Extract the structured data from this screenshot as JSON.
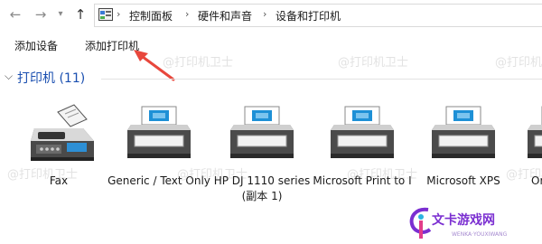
{
  "nav": {
    "back_icon": "arrow-left-icon",
    "forward_icon": "arrow-right-icon",
    "dropdown_icon": "chevron-down-icon",
    "up_icon": "arrow-up-icon"
  },
  "address": {
    "icon": "control-panel-icon",
    "crumbs": [
      "控制面板",
      "硬件和声音",
      "设备和打印机"
    ]
  },
  "toolbar": {
    "add_device": "添加设备",
    "add_printer": "添加打印机"
  },
  "group": {
    "label": "打印机 (11)"
  },
  "devices": [
    {
      "label": "Fax",
      "icon": "fax-icon"
    },
    {
      "label": "Generic / Text Only",
      "icon": "printer-icon"
    },
    {
      "label": "HP DJ 1110 series (副本 1)",
      "icon": "printer-icon"
    },
    {
      "label": "Microsoft Print to I",
      "icon": "printer-icon"
    },
    {
      "label": "Microsoft XPS",
      "icon": "printer-icon"
    },
    {
      "label": "Or",
      "icon": "printer-icon"
    }
  ],
  "watermark": "@打印机卫士",
  "annotation": {
    "color": "#e8473c"
  },
  "logo": {
    "text": "文卡游戏网",
    "sub": "WENKA·YOUXIWANG"
  }
}
